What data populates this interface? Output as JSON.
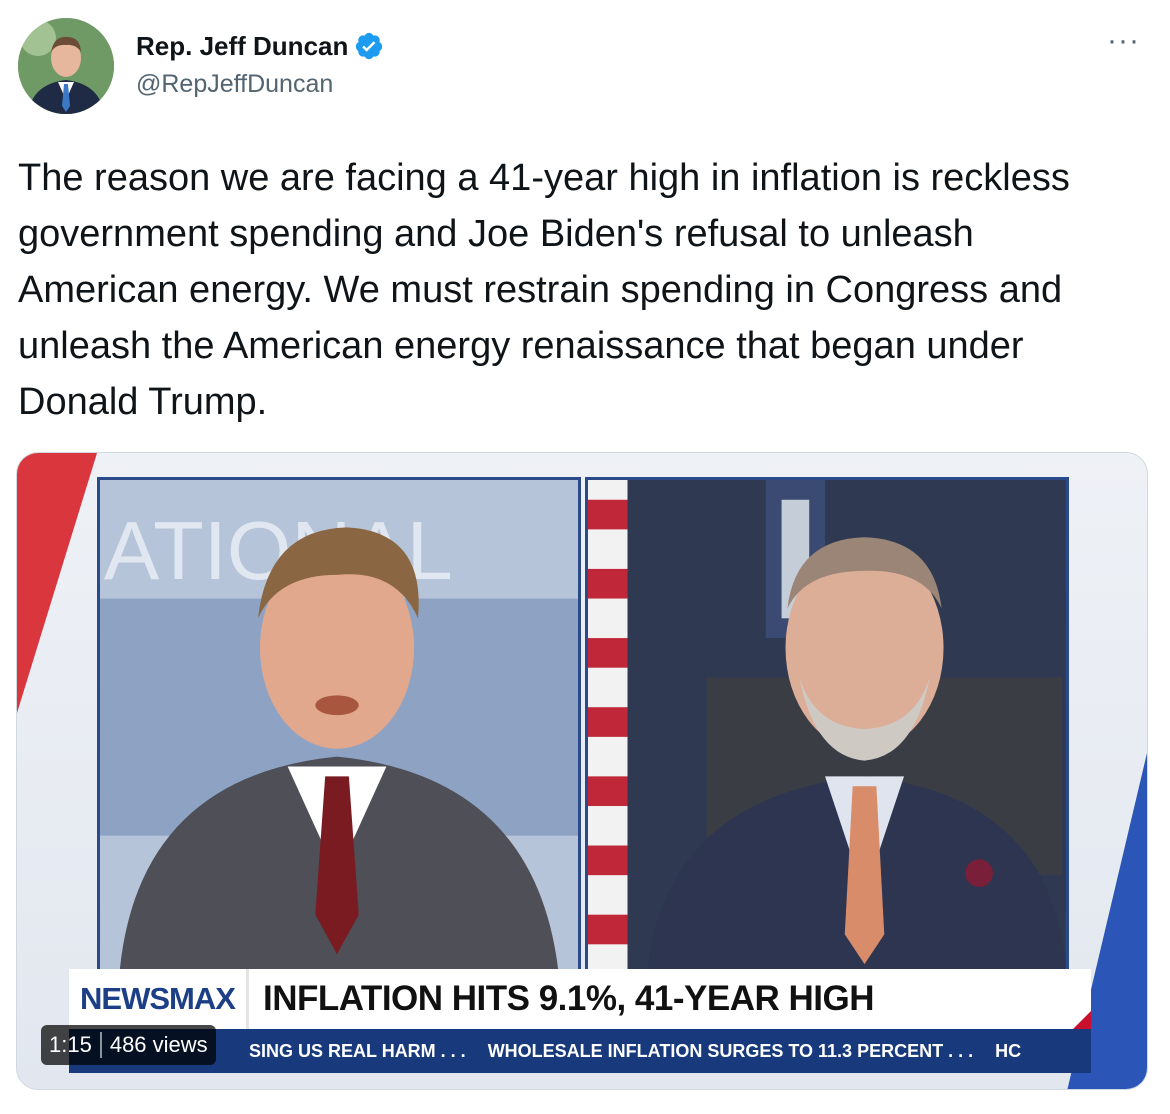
{
  "author": {
    "display_name": "Rep. Jeff Duncan",
    "handle": "@RepJeffDuncan",
    "avatar_icon": "profile-photo"
  },
  "menu": {
    "more_label": "···"
  },
  "tweet": {
    "text": "The reason we are facing a 41-year high in inflation is reckless government spending and Joe Biden's refusal to unleash American energy. We must restrain spending in Congress and unleash the American energy renaissance that began under Donald Trump."
  },
  "video": {
    "brand": "NEWSMAX",
    "headline": "INFLATION HITS 9.1%, 41-YEAR HIGH",
    "ticker": [
      "SING US REAL HARM . . .",
      "WHOLESALE INFLATION SURGES TO 11.3 PERCENT . . .",
      "HC"
    ],
    "background_lettering": "ATIONAL",
    "duration": "1:15",
    "views": "486 views"
  },
  "colors": {
    "verified_blue": "#1d9bf0",
    "newsmax_blue": "#1c3f86",
    "ticker_blue": "#183a7d",
    "accent_red": "#c8102e"
  }
}
